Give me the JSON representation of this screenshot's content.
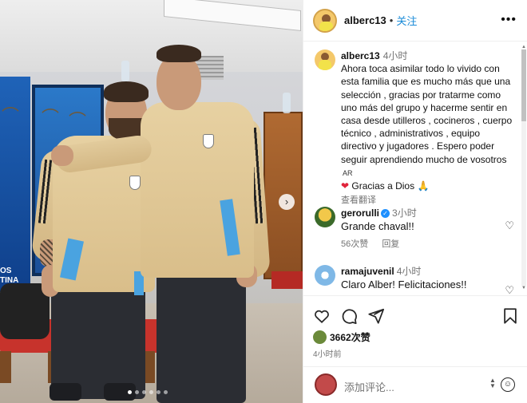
{
  "post": {
    "photo_banner_text": "OS\nTINA",
    "slide_count": 6,
    "active_slide": 1
  },
  "header": {
    "username": "alberc13",
    "separator": "•",
    "follow_label": "关注",
    "more_icon": "more-horizontal-icon"
  },
  "caption": {
    "username": "alberc13",
    "time": "4小时",
    "text": "Ahora toca asimilar todo lo vivido con esta familia que es mucho más que una selección , gracias por tratarme como uno más del grupo y hacerme sentir en casa desde utilleros , cocineros , cuerpo técnico , administrativos , equipo directivo y jugadores . Espero poder seguir aprendiendo mucho de vosotros",
    "ar_text": "AR",
    "heart_emoji": "❤",
    "thanks": "Gracias a Dios",
    "pray_emoji": "🙏",
    "translate_label": "查看翻译"
  },
  "comments": [
    {
      "username": "gerorulli",
      "verified": true,
      "time": "3小时",
      "text": "Grande chaval!!",
      "likes": "56次赞",
      "reply_label": "回复"
    },
    {
      "username": "ramajuvenil",
      "verified": false,
      "time": "4小时",
      "text": "Claro Alber! Felicitaciones!!",
      "likes": "",
      "reply_label": ""
    }
  ],
  "actions": {
    "like_icon": "heart-icon",
    "comment_icon": "comment-icon",
    "share_icon": "send-icon",
    "save_icon": "bookmark-icon",
    "likes_text": "3662次赞",
    "post_time": "4小时前"
  },
  "comment_input": {
    "placeholder": "添加评论..."
  },
  "colors": {
    "follow": "#1a8bd8",
    "muted": "#737373",
    "verified": "#1e90ff",
    "heart_emoji": "#e0243b"
  }
}
